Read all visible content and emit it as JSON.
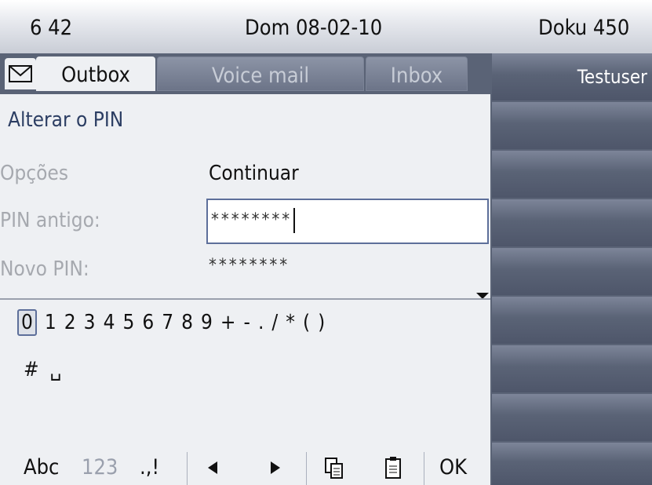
{
  "status": {
    "time": "6 42",
    "date": "Dom 08-02-10",
    "user": "Doku 450"
  },
  "tabs": [
    {
      "label": "Outbox",
      "active": true
    },
    {
      "label": "Voice mail",
      "active": false
    },
    {
      "label": "Inbox",
      "active": false
    }
  ],
  "form": {
    "title": "Alterar o PIN",
    "options_label": "Opções",
    "options_value": "Continuar",
    "old_pin_label": "PIN antigo:",
    "old_pin_value": "********",
    "new_pin_label": "Novo PIN:",
    "new_pin_value": "********"
  },
  "keyboard": {
    "chars_row1": [
      "0",
      "1",
      "2",
      "3",
      "4",
      "5",
      "6",
      "7",
      "8",
      "9",
      "+",
      "-",
      ".",
      "/",
      "*",
      "(",
      ")"
    ],
    "selected": "0",
    "chars_row2": [
      "#",
      "␣"
    ]
  },
  "softkeys": {
    "abc": "Abc",
    "num": "123",
    "punct": ".,!",
    "ok": "OK"
  },
  "right_panel": {
    "label": "Testuser"
  },
  "colors": {
    "accent": "#5d6f9a",
    "panel": "#5a6376",
    "background": "#eef0f3"
  }
}
